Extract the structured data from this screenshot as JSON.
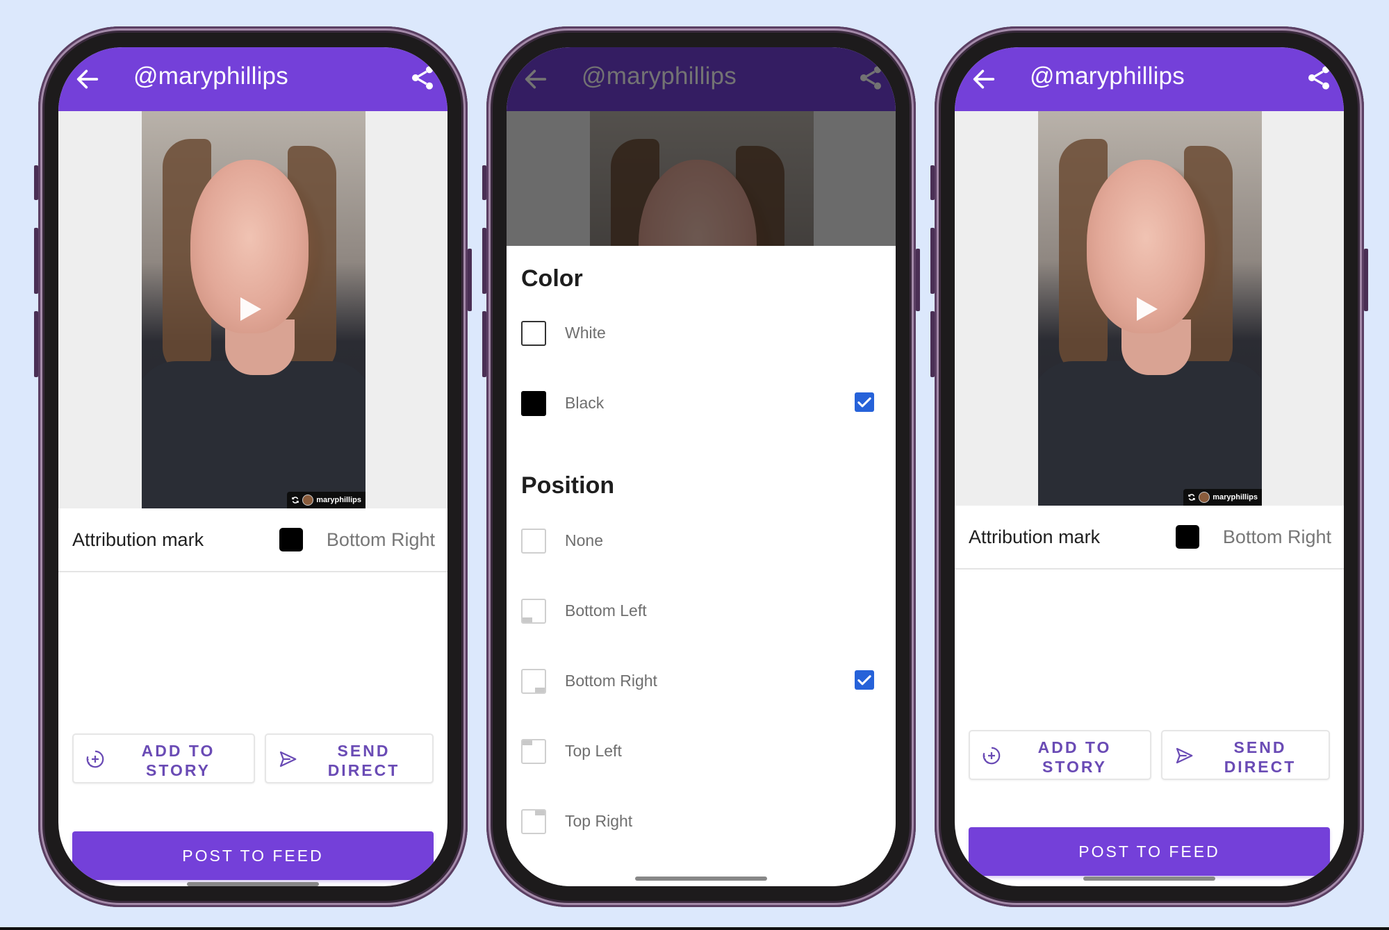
{
  "colors": {
    "page_bg": "#dce8fc",
    "brand_purple": "#7440d9",
    "button_text_purple": "#6a4bb5",
    "checkbox_blue": "#2662d9"
  },
  "phones": [
    {
      "screen": "share-preview",
      "appbar": {
        "title": "@maryphillips",
        "back_icon": "arrow-left-icon",
        "share_icon": "share-icon"
      },
      "media": {
        "watermark_user": "maryphillips",
        "play_icon": "play-icon"
      },
      "attribution": {
        "label": "Attribution mark",
        "color": "Black",
        "value": "Bottom Right"
      },
      "actions": {
        "add_to_story": "ADD TO STORY",
        "send_direct": "SEND DIRECT",
        "post_to_feed": "POST TO FEED"
      }
    },
    {
      "screen": "attribution-options-sheet",
      "appbar": {
        "title": "@maryphillips",
        "back_icon": "arrow-left-icon",
        "share_icon": "share-icon"
      },
      "sheet": {
        "color_title": "Color",
        "color_options": [
          {
            "label": "White",
            "selected": false
          },
          {
            "label": "Black",
            "selected": true
          }
        ],
        "position_title": "Position",
        "position_options": [
          {
            "label": "None",
            "selected": false
          },
          {
            "label": "Bottom Left",
            "selected": false
          },
          {
            "label": "Bottom Right",
            "selected": true
          },
          {
            "label": "Top Left",
            "selected": false
          },
          {
            "label": "Top Right",
            "selected": false
          }
        ]
      }
    },
    {
      "screen": "share-preview",
      "appbar": {
        "title": "@maryphillips",
        "back_icon": "arrow-left-icon",
        "share_icon": "share-icon"
      },
      "media": {
        "watermark_user": "maryphillips",
        "play_icon": "play-icon"
      },
      "attribution": {
        "label": "Attribution mark",
        "color": "Black",
        "value": "Bottom Right"
      },
      "actions": {
        "add_to_story": "ADD TO STORY",
        "send_direct": "SEND DIRECT",
        "post_to_feed": "POST TO FEED"
      }
    }
  ]
}
